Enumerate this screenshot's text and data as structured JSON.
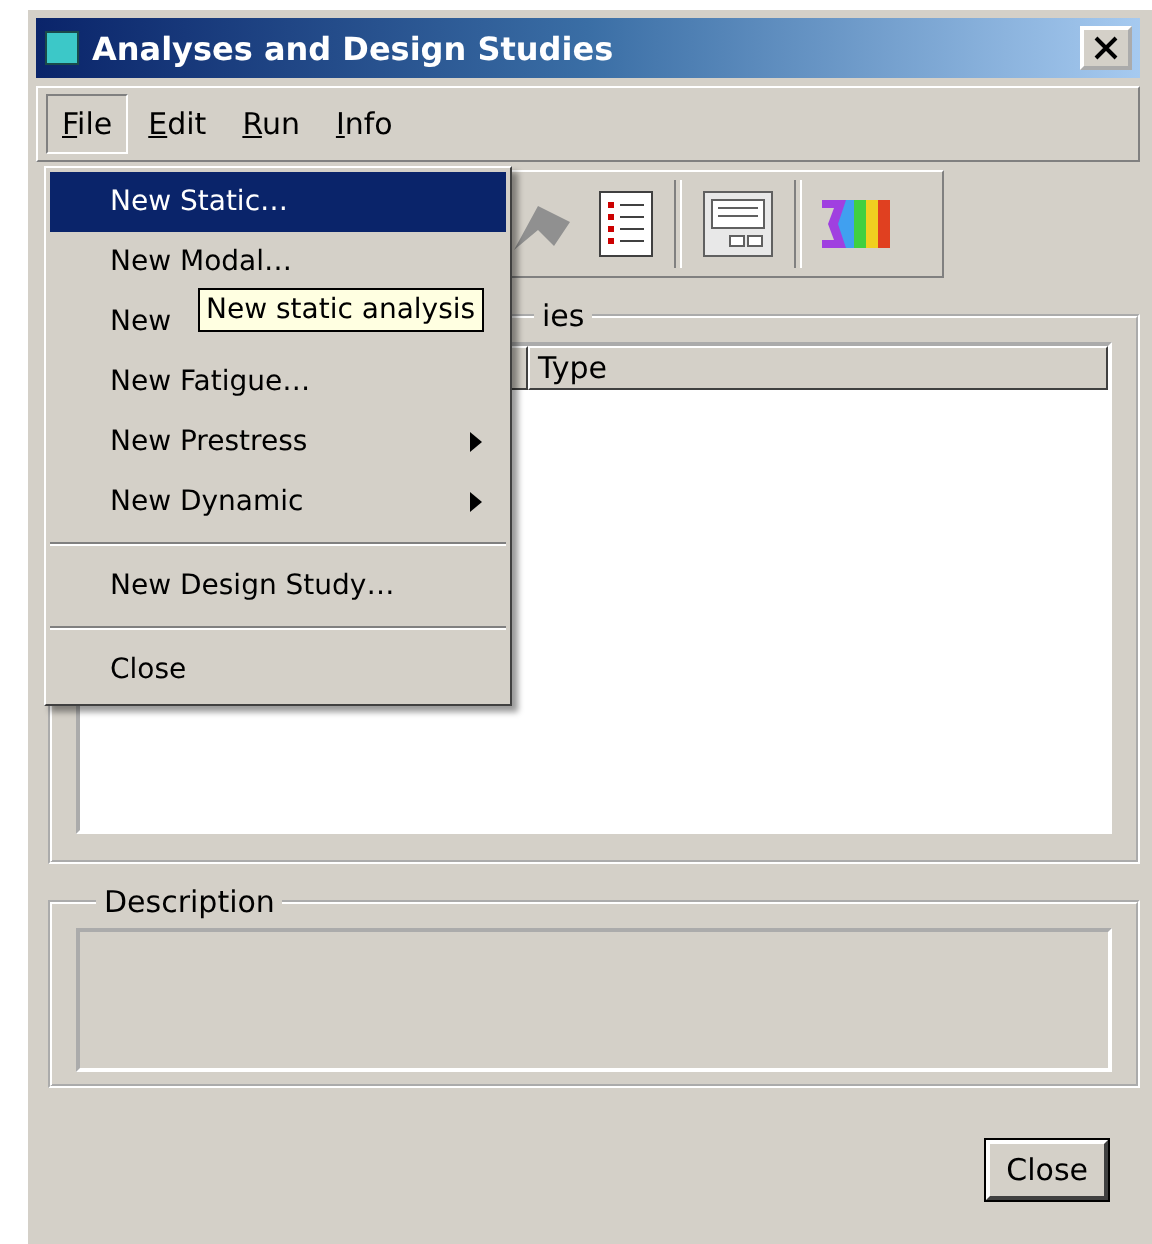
{
  "window": {
    "title": "Analyses and Design Studies"
  },
  "menu_bar": [
    {
      "label": "File",
      "selected": true
    },
    {
      "label": "Edit",
      "selected": false
    },
    {
      "label": "Run",
      "selected": false
    },
    {
      "label": "Info",
      "selected": false
    }
  ],
  "file_menu": [
    {
      "kind": "item",
      "label": "New Static…",
      "selected": true,
      "submenu": false
    },
    {
      "kind": "item",
      "label": "New Modal…",
      "selected": false,
      "submenu": false
    },
    {
      "kind": "item",
      "label": "New",
      "selected": false
    },
    {
      "kind": "item",
      "label": "New Fatigue…",
      "selected": false,
      "submenu": false
    },
    {
      "kind": "item",
      "label": "New Prestress",
      "selected": false,
      "submenu": true
    },
    {
      "kind": "item",
      "label": "New Dynamic",
      "selected": false,
      "submenu": true
    },
    {
      "kind": "separator"
    },
    {
      "kind": "item",
      "label": "New Design Study…",
      "selected": false,
      "submenu": false
    },
    {
      "kind": "separator"
    },
    {
      "kind": "item",
      "label": "Close",
      "selected": false,
      "submenu": false
    }
  ],
  "tooltip": "New static analysis",
  "studies_group": {
    "label": "ies",
    "columns": [
      "",
      "Type"
    ]
  },
  "description_group": {
    "label": "Description"
  },
  "buttons": [
    "Close"
  ]
}
